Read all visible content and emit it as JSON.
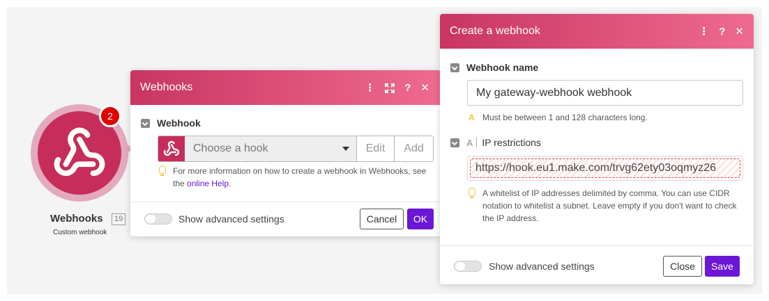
{
  "node": {
    "title": "Webhooks",
    "id": "19",
    "subtitle": "Custom webhook",
    "badge": "2"
  },
  "webhooks_panel": {
    "title": "Webhooks",
    "field_label": "Webhook",
    "select_placeholder": "Choose a hook",
    "edit_label": "Edit",
    "add_label": "Add",
    "help_text": "For more information on how to create a webhook in Webhooks, see the",
    "help_link": "online Help",
    "help_after": ".",
    "advanced_label": "Show advanced settings",
    "cancel_label": "Cancel",
    "ok_label": "OK"
  },
  "create_panel": {
    "title": "Create a webhook",
    "name_label": "Webhook name",
    "name_value": "My gateway-webhook webhook",
    "name_hint": "Must be between 1 and 128 characters long.",
    "ip_label": "IP restrictions",
    "ip_value": "https://hook.eu1.make.com/trvg62ety03oqmyz26",
    "ip_hint": "A whitelist of IP addresses delimited by comma. You can use CIDR notation to whitelist a subnet. Leave empty if you don't want to check the IP address.",
    "advanced_label": "Show advanced settings",
    "close_label": "Close",
    "save_label": "Save"
  },
  "colors": {
    "brand_pink": "#c62d5a",
    "header_gradient_start": "#c93563",
    "header_gradient_end": "#ee6b8f",
    "primary_button": "#6b17d4",
    "error_red": "#e0424a"
  }
}
